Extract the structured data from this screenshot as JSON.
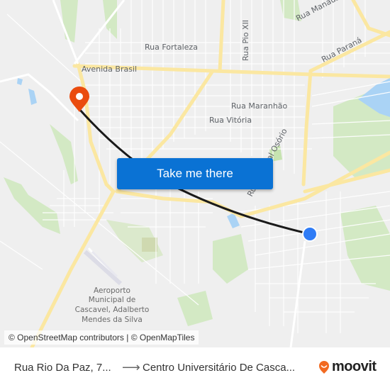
{
  "map": {
    "streets": [
      {
        "name": "Avenida Brasil"
      },
      {
        "name": "Rua Fortaleza"
      },
      {
        "name": "Rua Pio XII"
      },
      {
        "name": "Rua Manaus"
      },
      {
        "name": "Rua Paraná"
      },
      {
        "name": "Rua Maranhão"
      },
      {
        "name": "Rua Vitória"
      },
      {
        "name": "Rua General Osório"
      }
    ],
    "poi": {
      "airport_lines": [
        "Aeroporto",
        "Municipal de",
        "Cascavel, Adalberto",
        "Mendes da Silva"
      ]
    },
    "colors": {
      "background": "#efefef",
      "major_road": "#fbe7a1",
      "minor_road": "#ffffff",
      "park": "#d3e9c4",
      "water": "#aad3f5",
      "route": "#1a1a1a",
      "destination_pin": "#ea4c0f",
      "origin_dot": "#2f7cf6"
    },
    "markers": {
      "destination": {
        "type": "destination-pin"
      },
      "origin": {
        "type": "current-stop-dot"
      }
    }
  },
  "cta": {
    "label": "Take me there"
  },
  "attribution": {
    "text": "© OpenStreetMap contributors | © OpenMapTiles"
  },
  "footer": {
    "origin": "Rua Rio Da Paz, 7...",
    "arrow": "⟶",
    "destination": "Centro Universitário De Casca...",
    "brand": "moovit"
  }
}
